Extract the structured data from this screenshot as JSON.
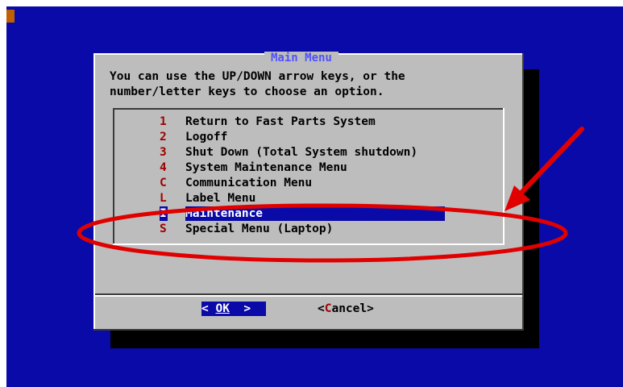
{
  "dialog": {
    "title": "Main Menu",
    "prompt_line1": "You can use the UP/DOWN arrow keys, or the",
    "prompt_line2": "number/letter keys to choose an option."
  },
  "menu_items": [
    {
      "key": "1",
      "label": "Return to Fast Parts System"
    },
    {
      "key": "2",
      "label": "Logoff"
    },
    {
      "key": "3",
      "label": "Shut Down (Total System shutdown)"
    },
    {
      "key": "4",
      "label": "System Maintenance Menu"
    },
    {
      "key": "C",
      "label": "Communication Menu"
    },
    {
      "key": "L",
      "label": "Label Menu"
    },
    {
      "key": "I",
      "label": "Maintenance",
      "selected": true
    },
    {
      "key": "S",
      "label": "Special Menu (Laptop)"
    }
  ],
  "buttons": {
    "ok_left": "< ",
    "ok_hot": "OK",
    "ok_right": "  >",
    "cancel_left": "<",
    "cancel_hot": "C",
    "cancel_rest": "ancel>"
  },
  "colors": {
    "screen_bg": "#0a0aa8",
    "dialog_bg": "#bdbdbd",
    "hotkey": "#a00000",
    "annotation": "#e00000"
  },
  "annotation": {
    "icons": [
      "red-arrow-icon",
      "red-ellipse-highlight"
    ]
  }
}
